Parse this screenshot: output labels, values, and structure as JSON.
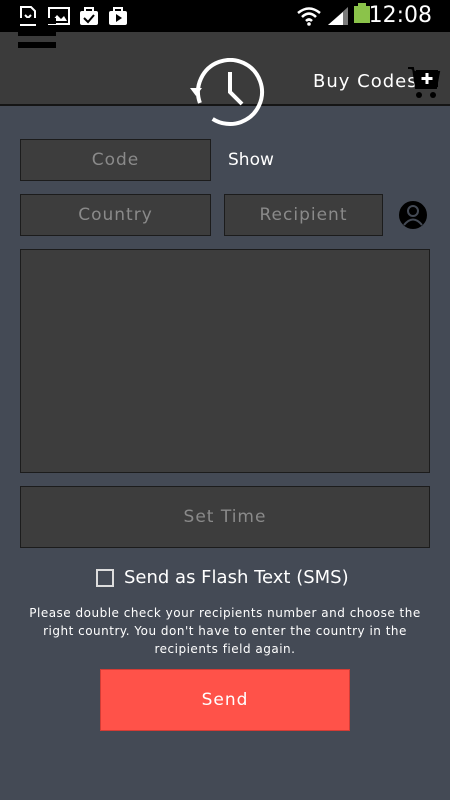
{
  "status_bar": {
    "time": "12:08",
    "icons": [
      "sim-card-icon",
      "image-icon",
      "bag-check-icon",
      "play-store-icon",
      "wifi-icon",
      "signal-icon",
      "battery-icon"
    ]
  },
  "app_bar": {
    "menu_icon": "hamburger-menu-icon",
    "logo_icon": "clock-history-icon",
    "buy_codes_label": "Buy Codes",
    "cart_icon": "cart-plus-icon"
  },
  "form": {
    "code": {
      "placeholder": "Code",
      "value": ""
    },
    "show_label": "Show",
    "country": {
      "placeholder": "Country",
      "value": ""
    },
    "recipient": {
      "placeholder": "Recipient",
      "value": ""
    },
    "contact_icon": "contact-person-icon",
    "message": {
      "value": ""
    },
    "set_time_label": "Set Time",
    "flash_text_label": "Send as Flash Text (SMS)",
    "flash_text_checked": false,
    "note": "Please double check your recipients number and choose the right country. You don't have to enter the country in the recipients field again.",
    "send_label": "Send"
  },
  "colors": {
    "background": "#444a55",
    "field": "#3d3d3d",
    "send_button": "#ff5249"
  }
}
